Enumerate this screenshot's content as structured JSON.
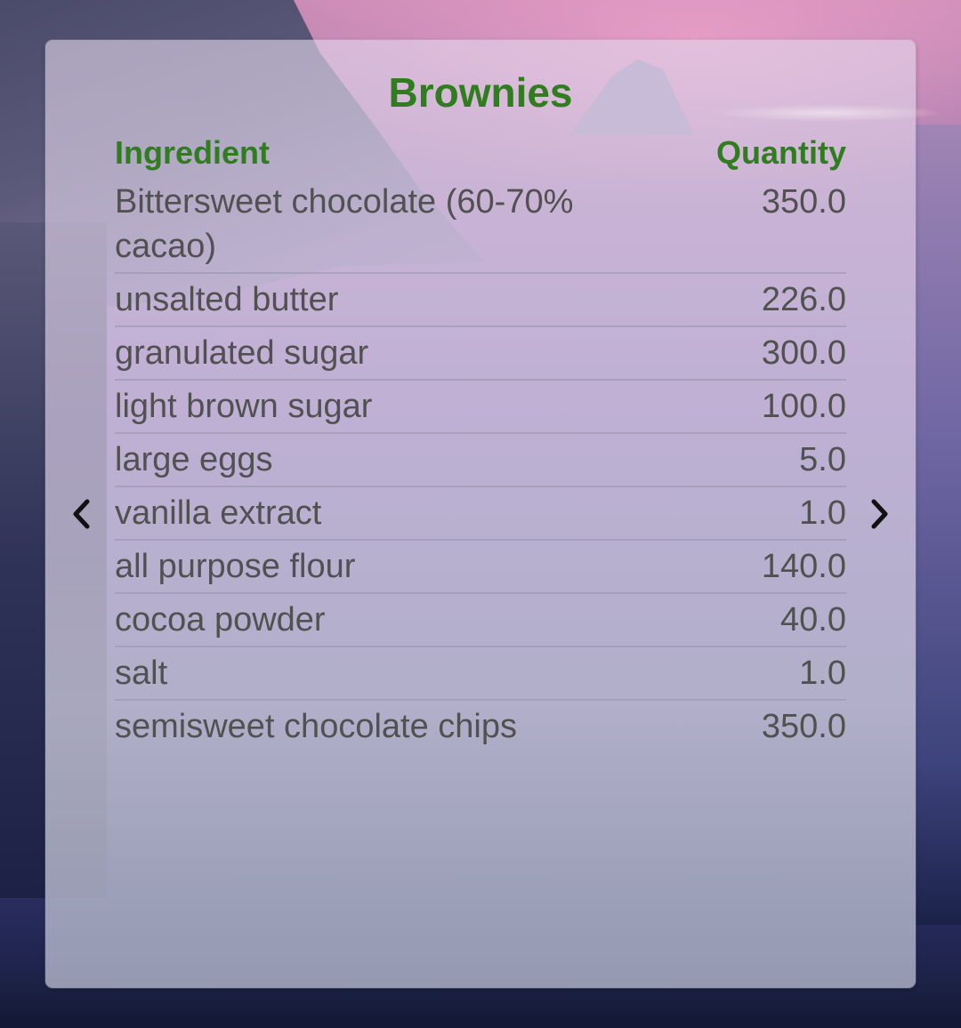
{
  "widget": {
    "title": "Brownies",
    "header": {
      "ingredient_label": "Ingredient",
      "quantity_label": "Quantity"
    },
    "rows": [
      {
        "ingredient": "Bittersweet chocolate (60-70% cacao)",
        "quantity": "350.0"
      },
      {
        "ingredient": "unsalted butter",
        "quantity": "226.0"
      },
      {
        "ingredient": "granulated sugar",
        "quantity": "300.0"
      },
      {
        "ingredient": "light brown sugar",
        "quantity": "100.0"
      },
      {
        "ingredient": "large eggs",
        "quantity": "5.0"
      },
      {
        "ingredient": "vanilla extract",
        "quantity": "1.0"
      },
      {
        "ingredient": "all purpose flour",
        "quantity": "140.0"
      },
      {
        "ingredient": "cocoa powder",
        "quantity": "40.0"
      },
      {
        "ingredient": "salt",
        "quantity": "1.0"
      },
      {
        "ingredient": "semisweet chocolate chips",
        "quantity": "350.0"
      }
    ],
    "nav": {
      "prev_icon": "chevron-left-icon",
      "next_icon": "chevron-right-icon"
    },
    "colors": {
      "accent": "#2f7d1f",
      "text": "#515151"
    }
  }
}
